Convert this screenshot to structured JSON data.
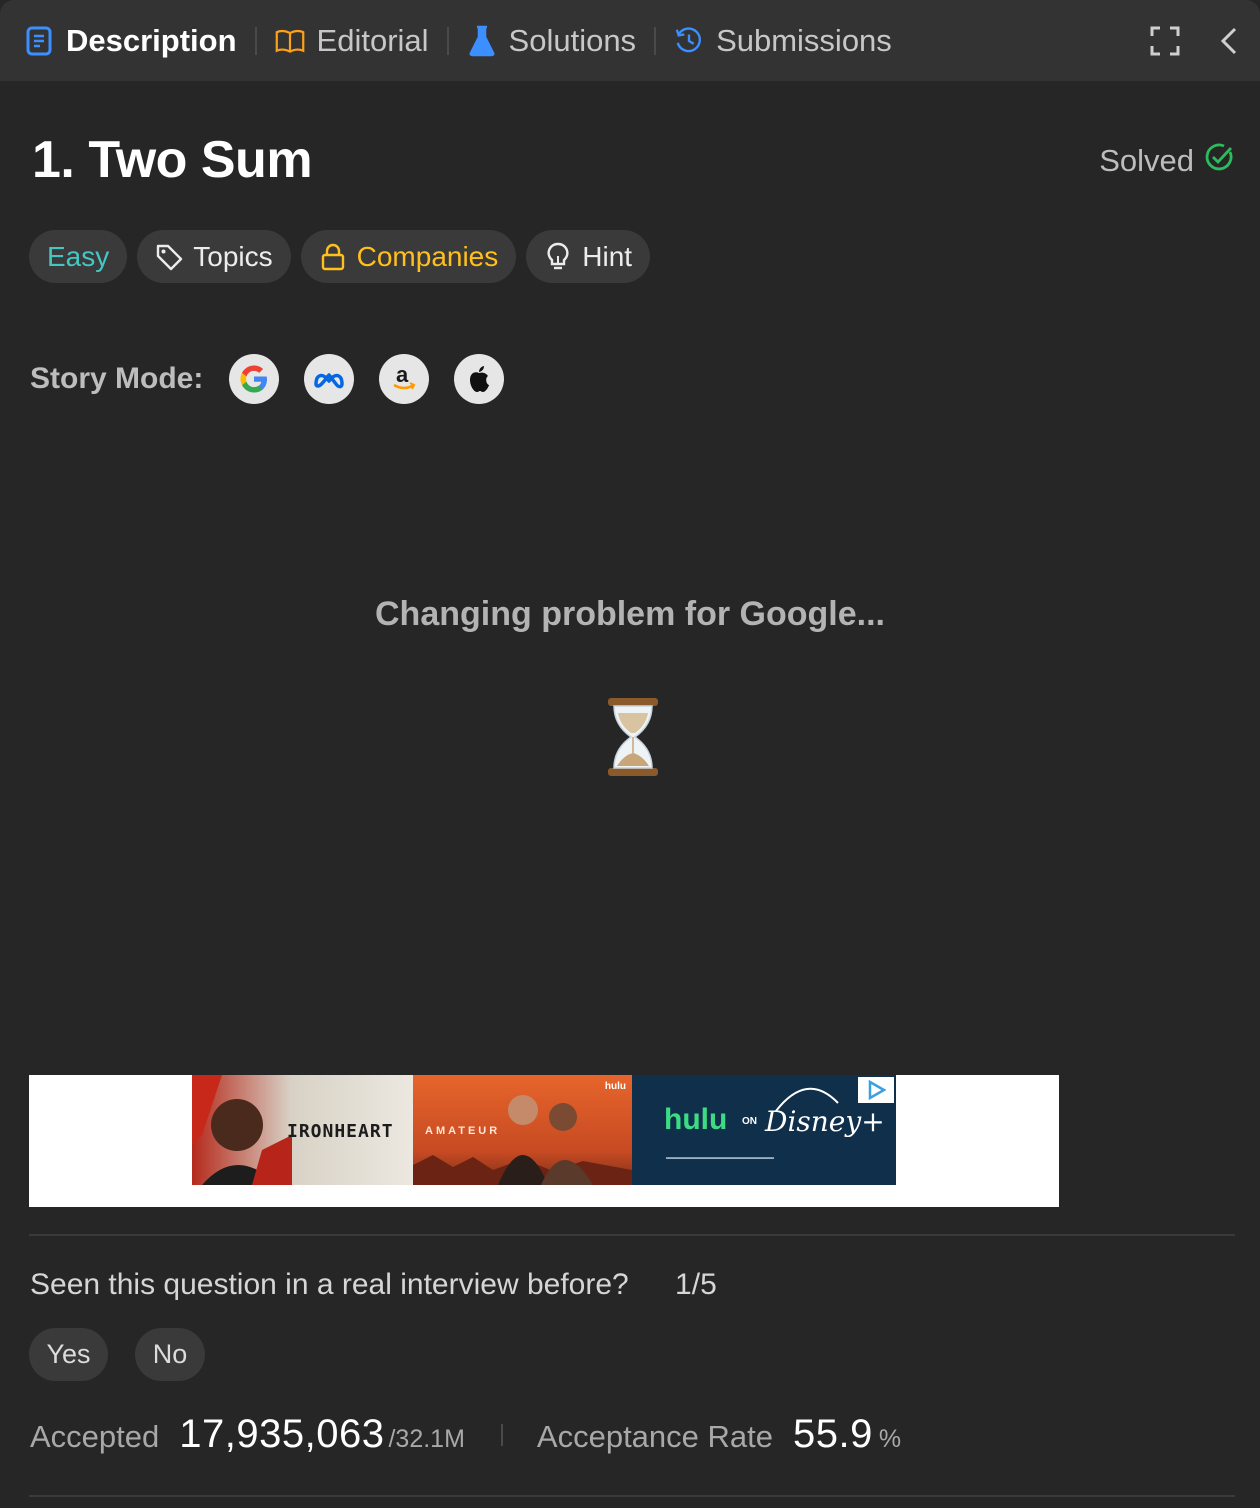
{
  "tabs": [
    {
      "label": "Description",
      "icon": "description-icon",
      "active": true
    },
    {
      "label": "Editorial",
      "icon": "book-icon",
      "active": false
    },
    {
      "label": "Solutions",
      "icon": "flask-icon",
      "active": false
    },
    {
      "label": "Submissions",
      "icon": "history-icon",
      "active": false
    }
  ],
  "problem": {
    "title": "1. Two Sum",
    "status": "Solved"
  },
  "tags": {
    "difficulty": "Easy",
    "topics": "Topics",
    "companies": "Companies",
    "hint": "Hint"
  },
  "story_mode": {
    "label": "Story Mode:",
    "companies": [
      "google-logo-icon",
      "meta-logo-icon",
      "amazon-logo-icon",
      "apple-logo-icon"
    ]
  },
  "loading": {
    "message": "Changing problem for Google..."
  },
  "ad": {
    "panel1_text": "IRONHEART",
    "panel2_text": "AMATEUR",
    "brand": "hulu",
    "on": "ON",
    "partner": "Disney+",
    "hulu_small": "hulu"
  },
  "interview": {
    "question": "Seen this question in a real interview before?",
    "fraction": "1/5",
    "yes": "Yes",
    "no": "No"
  },
  "stats": {
    "accepted_label": "Accepted",
    "accepted_value": "17,935,063",
    "accepted_total": "/32.1M",
    "rate_label": "Acceptance Rate",
    "rate_value": "55.9",
    "rate_unit": "%"
  },
  "colors": {
    "easy": "#46c6c2",
    "companies": "#ffc01e",
    "solved_check": "#2cbb5d",
    "background": "#262626",
    "tabbar": "#333333"
  }
}
